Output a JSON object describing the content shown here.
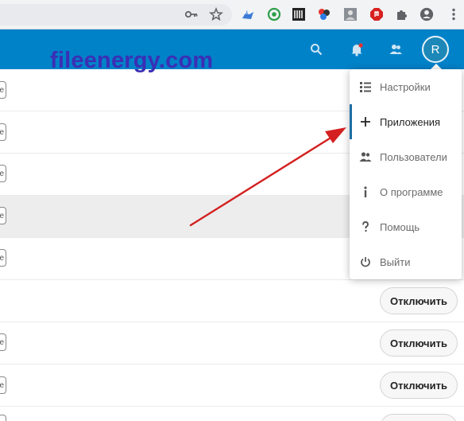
{
  "watermark": "fileenergy.com",
  "browser": {
    "icons": [
      "key-icon",
      "star-icon",
      "extension-icons",
      "puzzle-icon",
      "account-icon",
      "more-icon"
    ]
  },
  "header": {
    "avatar_initial": "R",
    "icons": [
      "search-icon",
      "bell-icon",
      "contacts-icon"
    ]
  },
  "menu": {
    "items": [
      {
        "label": "Настройки",
        "icon": "settings-list-icon"
      },
      {
        "label": "Приложения",
        "icon": "plus-icon",
        "active": true
      },
      {
        "label": "Пользователи",
        "icon": "users-icon"
      },
      {
        "label": "О программе",
        "icon": "info-icon"
      },
      {
        "label": "Помощь",
        "icon": "help-icon"
      },
      {
        "label": "Выйти",
        "icon": "logout-icon"
      }
    ]
  },
  "rows": {
    "edge_char": "e",
    "disable_label": "Отключить"
  },
  "colors": {
    "header_bg": "#0082c9",
    "accent": "#1d6fa5",
    "arrow": "#d42020",
    "watermark": "#3a2fb5"
  }
}
